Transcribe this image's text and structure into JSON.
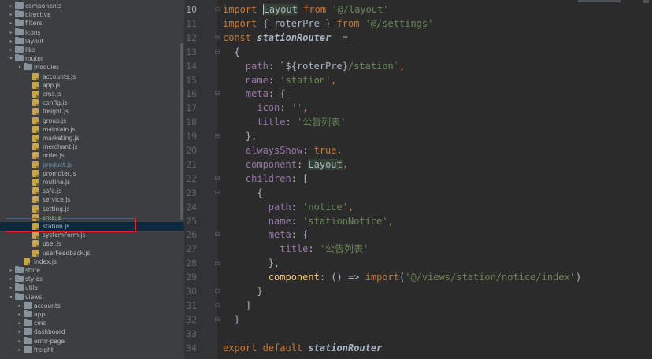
{
  "file_tree": {
    "items": [
      {
        "label": "components",
        "kind": "folder",
        "indent": 1,
        "expanded": false
      },
      {
        "label": "directive",
        "kind": "folder",
        "indent": 1,
        "expanded": false
      },
      {
        "label": "filters",
        "kind": "folder",
        "indent": 1,
        "expanded": false
      },
      {
        "label": "icons",
        "kind": "folder",
        "indent": 1,
        "expanded": false
      },
      {
        "label": "layout",
        "kind": "folder",
        "indent": 1,
        "expanded": false
      },
      {
        "label": "libs",
        "kind": "folder",
        "indent": 1,
        "expanded": false
      },
      {
        "label": "router",
        "kind": "folder",
        "indent": 1,
        "expanded": true
      },
      {
        "label": "modules",
        "kind": "folder",
        "indent": 2,
        "expanded": true
      },
      {
        "label": "accounts.js",
        "kind": "js",
        "indent": 3
      },
      {
        "label": "app.js",
        "kind": "js",
        "indent": 3
      },
      {
        "label": "cms.js",
        "kind": "js",
        "indent": 3
      },
      {
        "label": "config.js",
        "kind": "js",
        "indent": 3
      },
      {
        "label": "freight.js",
        "kind": "js",
        "indent": 3
      },
      {
        "label": "group.js",
        "kind": "js",
        "indent": 3
      },
      {
        "label": "maintain.js",
        "kind": "js",
        "indent": 3
      },
      {
        "label": "marketing.js",
        "kind": "js",
        "indent": 3
      },
      {
        "label": "merchant.js",
        "kind": "js",
        "indent": 3
      },
      {
        "label": "order.js",
        "kind": "js",
        "indent": 3
      },
      {
        "label": "product.js",
        "kind": "js",
        "indent": 3,
        "modified": true
      },
      {
        "label": "promoter.js",
        "kind": "js",
        "indent": 3
      },
      {
        "label": "routine.js",
        "kind": "js",
        "indent": 3
      },
      {
        "label": "safe.js",
        "kind": "js",
        "indent": 3
      },
      {
        "label": "service.js",
        "kind": "js",
        "indent": 3
      },
      {
        "label": "setting.js",
        "kind": "js",
        "indent": 3
      },
      {
        "label": "sms.js",
        "kind": "js",
        "indent": 3
      },
      {
        "label": "station.js",
        "kind": "js",
        "indent": 3,
        "selected": true
      },
      {
        "label": "systemForm.js",
        "kind": "js",
        "indent": 3
      },
      {
        "label": "user.js",
        "kind": "js",
        "indent": 3
      },
      {
        "label": "userFeedback.js",
        "kind": "js",
        "indent": 3
      },
      {
        "label": "index.js",
        "kind": "js",
        "indent": 2
      },
      {
        "label": "store",
        "kind": "folder",
        "indent": 1,
        "expanded": false
      },
      {
        "label": "styles",
        "kind": "folder",
        "indent": 1,
        "expanded": false
      },
      {
        "label": "utils",
        "kind": "folder",
        "indent": 1,
        "expanded": false
      },
      {
        "label": "views",
        "kind": "folder",
        "indent": 1,
        "expanded": true
      },
      {
        "label": "accounts",
        "kind": "folder",
        "indent": 2,
        "expanded": false
      },
      {
        "label": "app",
        "kind": "folder",
        "indent": 2,
        "expanded": false
      },
      {
        "label": "cms",
        "kind": "folder",
        "indent": 2,
        "expanded": false
      },
      {
        "label": "dashboard",
        "kind": "folder",
        "indent": 2,
        "expanded": false
      },
      {
        "label": "error-page",
        "kind": "folder",
        "indent": 2,
        "expanded": false
      },
      {
        "label": "freight",
        "kind": "folder",
        "indent": 2,
        "expanded": false
      }
    ]
  },
  "editor": {
    "current_line": "10",
    "lines": [
      {
        "num": "10",
        "tokens": [
          [
            "import",
            "kw"
          ],
          [
            " ",
            ""
          ],
          [
            "Layout",
            "hl caret"
          ],
          [
            " from ",
            "kw"
          ],
          [
            "'@/layout'",
            "str"
          ]
        ]
      },
      {
        "num": "11",
        "tokens": [
          [
            "import",
            "kw"
          ],
          [
            " { roterPre } ",
            ""
          ],
          [
            "from",
            "kw"
          ],
          [
            " ",
            ""
          ],
          [
            "'@/settings'",
            "str"
          ]
        ]
      },
      {
        "num": "12",
        "tokens": [
          [
            "const",
            "kw"
          ],
          [
            " ",
            ""
          ],
          [
            "stationRouter",
            "it"
          ],
          [
            "  =",
            ""
          ]
        ]
      },
      {
        "num": "13",
        "tokens": [
          [
            "  {",
            ""
          ]
        ]
      },
      {
        "num": "14",
        "tokens": [
          [
            "    ",
            ""
          ],
          [
            "path",
            "prop"
          ],
          [
            ": `${roterPre}",
            ""
          ],
          [
            "/station`",
            "str"
          ],
          [
            ",",
            "kw"
          ]
        ]
      },
      {
        "num": "15",
        "tokens": [
          [
            "    ",
            ""
          ],
          [
            "name",
            "prop"
          ],
          [
            ": ",
            ""
          ],
          [
            "'station'",
            "str"
          ],
          [
            ",",
            "kw"
          ]
        ]
      },
      {
        "num": "16",
        "tokens": [
          [
            "    ",
            ""
          ],
          [
            "meta",
            "prop"
          ],
          [
            ": {",
            ""
          ]
        ]
      },
      {
        "num": "17",
        "tokens": [
          [
            "      ",
            ""
          ],
          [
            "icon",
            "prop"
          ],
          [
            ": ",
            ""
          ],
          [
            "''",
            "str"
          ],
          [
            ",",
            "kw"
          ]
        ]
      },
      {
        "num": "18",
        "tokens": [
          [
            "      ",
            ""
          ],
          [
            "title",
            "prop"
          ],
          [
            ": ",
            ""
          ],
          [
            "'公告列表'",
            "str"
          ]
        ]
      },
      {
        "num": "19",
        "tokens": [
          [
            "    },",
            ""
          ]
        ]
      },
      {
        "num": "20",
        "tokens": [
          [
            "    ",
            ""
          ],
          [
            "alwaysShow",
            "prop"
          ],
          [
            ": ",
            ""
          ],
          [
            "true",
            "kw"
          ],
          [
            ",",
            "kw"
          ]
        ]
      },
      {
        "num": "21",
        "tokens": [
          [
            "    ",
            ""
          ],
          [
            "component",
            "prop"
          ],
          [
            ": ",
            ""
          ],
          [
            "Layout",
            "hl"
          ],
          [
            ",",
            "kw"
          ]
        ]
      },
      {
        "num": "22",
        "tokens": [
          [
            "    ",
            ""
          ],
          [
            "children",
            "prop"
          ],
          [
            ": [",
            ""
          ]
        ]
      },
      {
        "num": "23",
        "tokens": [
          [
            "      {",
            ""
          ]
        ]
      },
      {
        "num": "24",
        "tokens": [
          [
            "        ",
            ""
          ],
          [
            "path",
            "prop"
          ],
          [
            ": ",
            ""
          ],
          [
            "'notice'",
            "str"
          ],
          [
            ",",
            "kw"
          ]
        ]
      },
      {
        "num": "25",
        "tokens": [
          [
            "        ",
            ""
          ],
          [
            "name",
            "prop"
          ],
          [
            ": ",
            ""
          ],
          [
            "'stationNotice'",
            "str"
          ],
          [
            ",",
            "kw"
          ]
        ]
      },
      {
        "num": "26",
        "tokens": [
          [
            "        ",
            ""
          ],
          [
            "meta",
            "prop"
          ],
          [
            ": {",
            ""
          ]
        ]
      },
      {
        "num": "27",
        "tokens": [
          [
            "          ",
            ""
          ],
          [
            "title",
            "prop"
          ],
          [
            ": ",
            ""
          ],
          [
            "'公告列表'",
            "str"
          ]
        ]
      },
      {
        "num": "28",
        "tokens": [
          [
            "        },",
            ""
          ]
        ]
      },
      {
        "num": "29",
        "tokens": [
          [
            "        ",
            ""
          ],
          [
            "component",
            "fn"
          ],
          [
            ": () => ",
            ""
          ],
          [
            "import",
            "kw"
          ],
          [
            "(",
            ""
          ],
          [
            "'@/views/station/notice/index'",
            "str"
          ],
          [
            ")",
            ""
          ]
        ]
      },
      {
        "num": "30",
        "tokens": [
          [
            "      }",
            ""
          ]
        ]
      },
      {
        "num": "31",
        "tokens": [
          [
            "    ]",
            ""
          ]
        ]
      },
      {
        "num": "32",
        "tokens": [
          [
            "  }",
            ""
          ]
        ]
      },
      {
        "num": "33",
        "tokens": [
          [
            "",
            ""
          ]
        ]
      },
      {
        "num": "34",
        "tokens": [
          [
            "export",
            "kw"
          ],
          [
            " ",
            ""
          ],
          [
            "default",
            "kw"
          ],
          [
            " ",
            ""
          ],
          [
            "stationRouter",
            "it"
          ]
        ]
      }
    ]
  }
}
